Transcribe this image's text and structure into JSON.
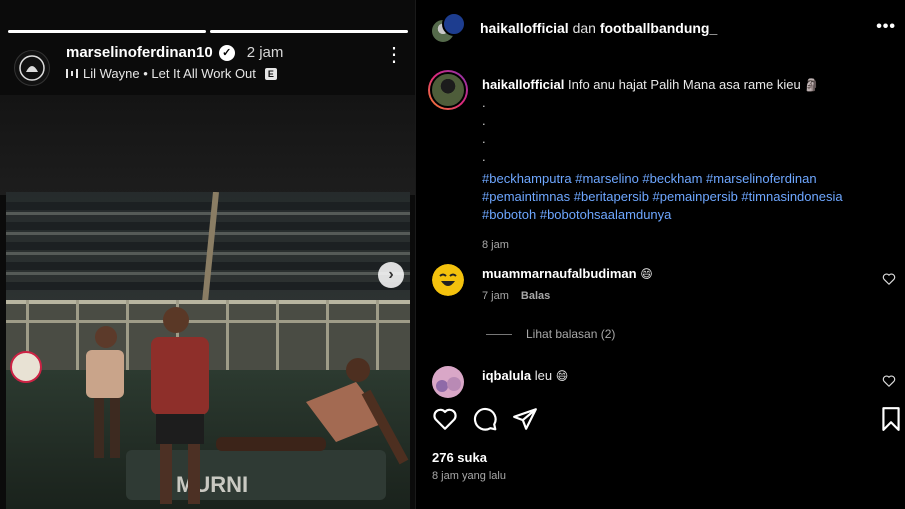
{
  "story": {
    "username": "marselinoferdinan10",
    "time": "2 jam",
    "music": "Lil Wayne • Let It All Work Out",
    "explicit_badge": "E",
    "photo_banner": "MURNI"
  },
  "post": {
    "collab_user_1": "haikallofficial",
    "collab_conj": "dan",
    "collab_user_2": "footballbandung_",
    "caption": {
      "username": "haikallofficial",
      "text": "Info anu hajat Palih Mana asa rame kieu",
      "dots": [
        ".",
        ".",
        ".",
        "."
      ],
      "hashtags": "#beckhamputra #marselino #beckham #marselinoferdinan #pemaintimnas #beritapersib #pemainpersib #timnasindonesia #bobotoh #bobotohsaalamdunya",
      "time": "8 jam"
    },
    "comments": [
      {
        "username": "muammarnaufalbudiman",
        "text": "",
        "time": "7 jam",
        "reply": "Balas"
      },
      {
        "username": "iqbalula",
        "text": "leu",
        "time": "",
        "reply": ""
      }
    ],
    "view_replies": "Lihat balasan (2)",
    "likes": "276 suka",
    "time_ago": "8 jam yang lalu"
  },
  "colors": {
    "hashtag": "#6ea7ff",
    "background": "#000000"
  },
  "icons": [
    "heart-icon",
    "comment-icon",
    "share-icon",
    "bookmark-icon",
    "more-icon",
    "chevron-right-icon",
    "verified-icon",
    "music-icon"
  ]
}
